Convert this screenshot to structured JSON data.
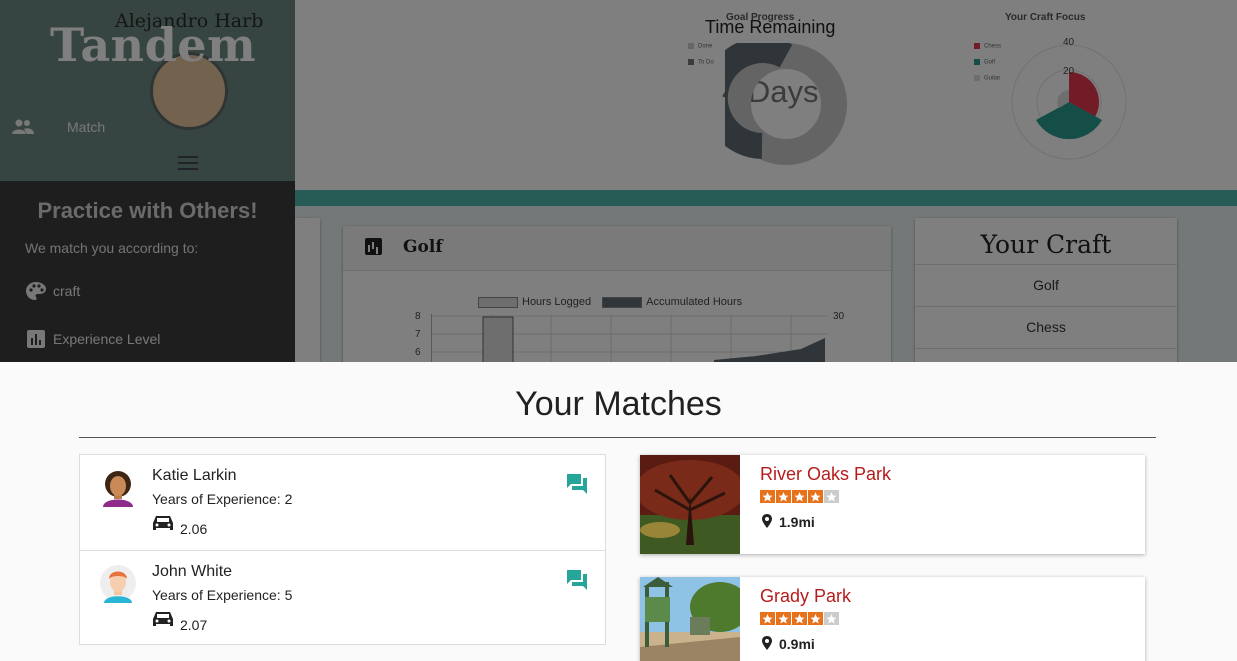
{
  "sidebar": {
    "brand": "Tandem",
    "nav": [
      {
        "label": "Match",
        "icon": "people-icon"
      }
    ],
    "practice_title": "Practice with Others!",
    "practice_subtitle": "We match you according to:",
    "criteria": [
      {
        "label": "craft",
        "icon": "palette-icon"
      },
      {
        "label": "Experience Level",
        "icon": "bar-chart-icon"
      }
    ]
  },
  "dashboard": {
    "profile_name": "Alejandro Harb",
    "time_remaining_title": "Time Remaining",
    "time_remaining_value": "4 Days",
    "goal_progress": {
      "title": "Goal Progress",
      "legend": [
        "Done",
        "To Do"
      ]
    },
    "craft_focus": {
      "title": "Your Craft Focus",
      "legend": [
        "Chess",
        "Golf",
        "Guitar"
      ],
      "ticks": [
        "40",
        "20"
      ]
    },
    "golf_card": {
      "title": "Golf",
      "legend": [
        "Hours Logged",
        "Accumulated Hours"
      ],
      "left_ticks": [
        "8",
        "7",
        "6"
      ],
      "right_ticks": [
        "30"
      ]
    },
    "your_craft": {
      "title": "Your Craft",
      "items": [
        "Golf",
        "Chess"
      ]
    }
  },
  "matches": {
    "title": "Your Matches",
    "people": [
      {
        "name": "Katie Larkin",
        "experience": "Years of Experience: 2",
        "distance": "2.06",
        "avatar": "woman-avatar-icon"
      },
      {
        "name": "John White",
        "experience": "Years of Experience: 5",
        "distance": "2.07",
        "avatar": "man-avatar-icon"
      }
    ],
    "parks": [
      {
        "name": "River Oaks Park",
        "rating": 4,
        "max_rating": 5,
        "distance": "1.9mi"
      },
      {
        "name": "Grady Park",
        "rating": 4,
        "max_rating": 5,
        "distance": "0.9mi"
      }
    ]
  },
  "colors": {
    "accent_teal": "#26a69a",
    "park_name": "#b71c1c",
    "star_orange": "#e8711c",
    "sidebar_top": "#6f8a84",
    "sidebar_bottom": "#3c3c3c"
  }
}
